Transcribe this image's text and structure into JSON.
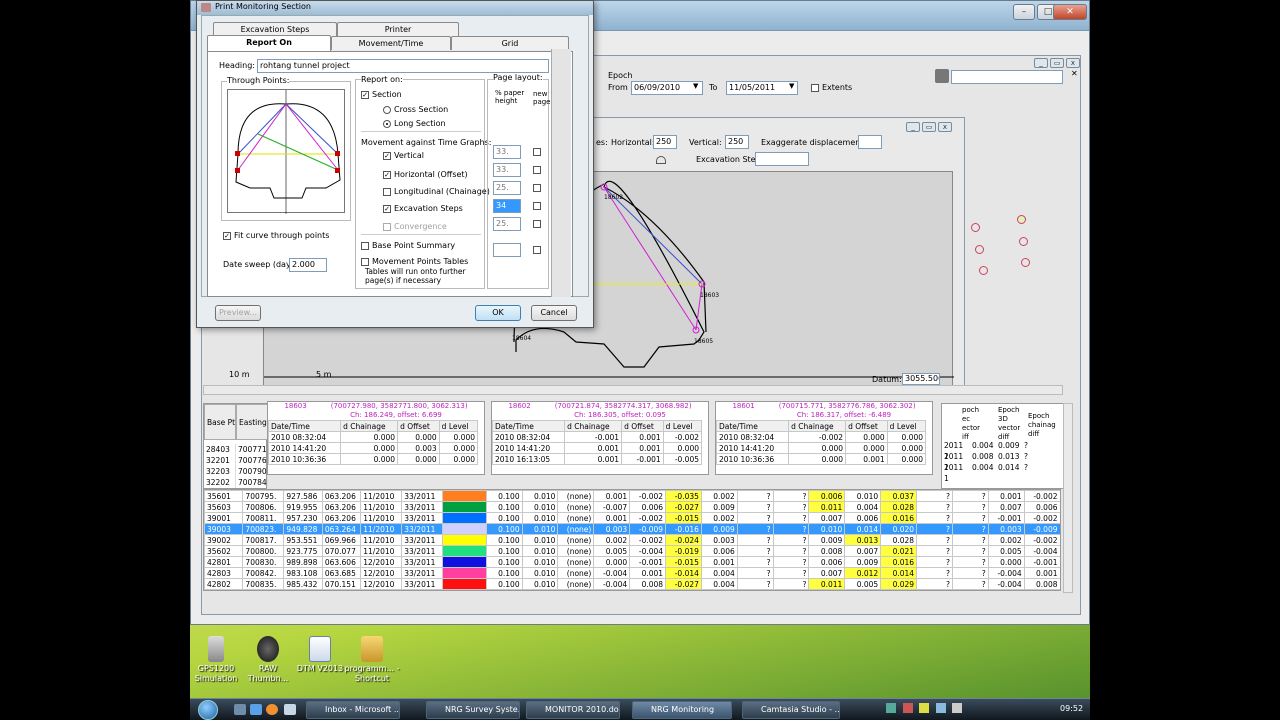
{
  "dialog": {
    "title": "Print Monitoring Section",
    "tabs_row1": [
      "Excavation Steps",
      "Printer"
    ],
    "tabs_row2": [
      "Report On",
      "Movement/Time",
      "Grid"
    ],
    "heading_label": "Heading:",
    "heading_value": "rohtang tunnel project",
    "through_points_label": "Through Points:",
    "fit_curve": "Fit curve through points",
    "date_sweep_label": "Date sweep (days):",
    "date_sweep_value": "2.000",
    "report_on_label": "Report on:",
    "section": "Section",
    "cross_section": "Cross Section",
    "long_section": "Long Section",
    "mat_label": "Movement against Time Graphs:",
    "vertical": "Vertical",
    "horizontal": "Horizontal (Offset)",
    "longitudinal": "Longitudinal (Chainage)",
    "excavation_steps": "Excavation Steps",
    "convergence": "Convergence",
    "base_point_summary": "Base Point Summary",
    "movement_points_tables": "Movement Points Tables",
    "tables_note": "Tables will run onto further page(s) if necessary",
    "page_layout_label": "Page layout:",
    "pct_paper": "% paper height",
    "new_page": "new page",
    "pct_values": [
      "33.",
      "33.",
      "25.",
      "34",
      "25.",
      ""
    ],
    "preview": "Preview...",
    "ok": "OK",
    "cancel": "Cancel"
  },
  "main": {
    "epoch_label": "Epoch",
    "from_label": "From",
    "from_value": "06/09/2010",
    "to_label": "To",
    "to_value": "11/05/2011",
    "extents": "Extents",
    "horizontal_label": "Horizontal: 1:",
    "horizontal_value": "250",
    "vertical_label": "Vertical: 1:",
    "vertical_value": "250",
    "exaggerate": "Exaggerate displacement by:",
    "excavation_step": "Excavation Step",
    "partial_label": "es:",
    "datum_label": "Datum:",
    "datum_value": "3055.500",
    "scale_10m": "10 m",
    "scale_5m": "5 m",
    "pt_18602": "18602",
    "pt_18603": "18603",
    "pt_18604": "18604",
    "pt_18605": "18605"
  },
  "pointpanels": [
    {
      "id": "18603",
      "coords": "(700727.980, 3582771.800, 3062.313)",
      "ch": "Ch: 186.249, offset: 6.699",
      "rows": [
        [
          "2010 08:32:04",
          "0.000",
          "0.000",
          "0.000"
        ],
        [
          "2010 14:41:20",
          "0.000",
          "0.003",
          "0.000"
        ],
        [
          "2010 10:36:36",
          "0.000",
          "0.000",
          "0.000"
        ]
      ]
    },
    {
      "id": "18602",
      "coords": "(700721.874, 3582774.317, 3068.982)",
      "ch": "Ch: 186.305, offset: 0.095",
      "rows": [
        [
          "2010 08:32:04",
          "-0.001",
          "0.001",
          "-0.002"
        ],
        [
          "2010 14:41:20",
          "0.001",
          "0.001",
          "0.000"
        ],
        [
          "2010 16:13:05",
          "0.001",
          "-0.001",
          "-0.005"
        ]
      ]
    },
    {
      "id": "18601",
      "coords": "(700715.771, 3582776.786, 3062.302)",
      "ch": "Ch: 186.317, offset: -6.489",
      "rows": [
        [
          "2010 08:32:04",
          "-0.002",
          "0.000",
          "0.000"
        ],
        [
          "2010 14:41:20",
          "0.000",
          "0.000",
          "0.000"
        ],
        [
          "2010 10:36:36",
          "0.000",
          "0.001",
          "0.000"
        ]
      ]
    }
  ],
  "panel_headers": [
    "Date/Time",
    "d Chainage",
    "d Offset",
    "d Level"
  ],
  "left_table": {
    "headers": [
      "Base Pt",
      "Easting"
    ],
    "rows": [
      [
        "28403",
        "700771"
      ],
      [
        "32201",
        "700776"
      ],
      [
        "32203",
        "700790"
      ],
      [
        "32202",
        "700784"
      ]
    ]
  },
  "epoch_headers": [
    "Date/Ti",
    "Epoch 3D vector diff",
    "Epoch chainag diff"
  ],
  "epoch_rows": [
    [
      "2011 1",
      "0.004",
      "0.009",
      "?"
    ],
    [
      "2011 1",
      "0.008",
      "0.013",
      "?"
    ],
    [
      "2011 1",
      "0.004",
      "0.014",
      "?"
    ]
  ],
  "partial_top": [
    "poch",
    "ec",
    "ector",
    "iff"
  ],
  "data_rows": [
    {
      "bp": "35601",
      "e": "700795.",
      "n": "927.586",
      "z": "063.206",
      "d1": "11/2010",
      "d2": "33/2011",
      "color": "#ff7f1e",
      "v": [
        "0.100",
        "0.010",
        "(none)",
        "0.001",
        "-0.002",
        "-0.035",
        "0.002",
        "?",
        "?",
        "0.006",
        "0.010",
        "0.037",
        "?",
        "?",
        "0.001",
        "-0.002",
        "-0.035",
        "0.002",
        "0.035",
        "?"
      ],
      "hl": [
        5,
        11,
        9
      ]
    },
    {
      "bp": "35603",
      "e": "700806.",
      "n": "919.955",
      "z": "063.206",
      "d1": "11/2010",
      "d2": "33/2011",
      "color": "#00a040",
      "v": [
        "0.100",
        "0.010",
        "(none)",
        "-0.007",
        "0.006",
        "-0.027",
        "0.009",
        "?",
        "?",
        "0.011",
        "0.004",
        "0.028",
        "?",
        "?",
        "0.007",
        "0.006",
        "-0.027",
        "0.009",
        "0.028",
        "?"
      ],
      "hl": [
        5,
        11,
        9
      ]
    },
    {
      "bp": "39001",
      "e": "700811.",
      "n": "957.230",
      "z": "063.206",
      "d1": "11/2010",
      "d2": "33/2011",
      "color": "#0070ff",
      "v": [
        "0.100",
        "0.010",
        "(none)",
        "0.001",
        "-0.002",
        "-0.015",
        "0.002",
        "?",
        "?",
        "0.007",
        "0.006",
        "0.016",
        "?",
        "?",
        "-0.001",
        "-0.002",
        "-0.015",
        "0.002",
        "0.015",
        "?"
      ],
      "hl": [
        5,
        11
      ]
    },
    {
      "bp": "39003",
      "e": "700823.",
      "n": "949.828",
      "z": "063.264",
      "d1": "11/2010",
      "d2": "33/2011",
      "color": "#d0d0ff",
      "v": [
        "0.100",
        "0.010",
        "(none)",
        "0.003",
        "-0.009",
        "-0.016",
        "0.009",
        "?",
        "?",
        "0.010",
        "0.014",
        "0.020",
        "?",
        "?",
        "0.003",
        "-0.009",
        "-0.016",
        "0.009",
        "0.019",
        "?"
      ],
      "hl": [],
      "sel": true
    },
    {
      "bp": "39002",
      "e": "700817.",
      "n": "953.551",
      "z": "069.966",
      "d1": "11/2010",
      "d2": "33/2011",
      "color": "#ffff00",
      "v": [
        "0.100",
        "0.010",
        "(none)",
        "0.002",
        "-0.002",
        "-0.024",
        "0.003",
        "?",
        "?",
        "0.009",
        "0.013",
        "0.028",
        "?",
        "?",
        "0.002",
        "-0.002",
        "-0.024",
        "0.003",
        "0.024",
        "?"
      ],
      "hl": [
        5,
        10
      ]
    },
    {
      "bp": "35602",
      "e": "700800.",
      "n": "923.775",
      "z": "070.077",
      "d1": "11/2010",
      "d2": "33/2011",
      "color": "#20e080",
      "v": [
        "0.100",
        "0.010",
        "(none)",
        "0.005",
        "-0.004",
        "-0.019",
        "0.006",
        "?",
        "?",
        "0.008",
        "0.007",
        "0.021",
        "?",
        "?",
        "0.005",
        "-0.004",
        "-0.019",
        "0.006",
        "0.020",
        "?"
      ],
      "hl": [
        5,
        11
      ]
    },
    {
      "bp": "42801",
      "e": "700830.",
      "n": "989.898",
      "z": "063.606",
      "d1": "12/2010",
      "d2": "33/2011",
      "color": "#1010e0",
      "v": [
        "0.100",
        "0.010",
        "(none)",
        "0.000",
        "-0.001",
        "-0.015",
        "0.001",
        "?",
        "?",
        "0.006",
        "0.009",
        "0.016",
        "?",
        "?",
        "0.000",
        "-0.001",
        "-0.015",
        "0.001",
        "0.015",
        "?"
      ],
      "hl": [
        5,
        11
      ]
    },
    {
      "bp": "42803",
      "e": "700842.",
      "n": "983.108",
      "z": "063.685",
      "d1": "12/2010",
      "d2": "33/2011",
      "color": "#ff40a0",
      "v": [
        "0.100",
        "0.010",
        "(none)",
        "-0.004",
        "0.001",
        "-0.014",
        "0.004",
        "?",
        "?",
        "0.007",
        "0.012",
        "0.014",
        "?",
        "?",
        "-0.004",
        "0.001",
        "-0.014",
        "0.004",
        "0.015",
        "?"
      ],
      "hl": [
        5,
        10,
        11
      ]
    },
    {
      "bp": "42802",
      "e": "700835.",
      "n": "985.432",
      "z": "070.151",
      "d1": "12/2010",
      "d2": "33/2011",
      "color": "#ff1010",
      "v": [
        "0.100",
        "0.010",
        "(none)",
        "-0.004",
        "0.008",
        "-0.027",
        "0.004",
        "?",
        "?",
        "0.011",
        "0.005",
        "0.029",
        "?",
        "?",
        "-0.004",
        "0.008",
        "-0.027",
        "0.004",
        "0.027",
        "?"
      ],
      "hl": [
        5,
        9,
        11
      ]
    }
  ],
  "desktop_icons": [
    {
      "label": "GPS1200 Simulation"
    },
    {
      "label": "RAW Thumbn..."
    },
    {
      "label": "DTM V2013"
    },
    {
      "label": "programm... - Shortcut"
    }
  ],
  "taskbar": {
    "items": [
      "Inbox - Microsoft ...",
      "NRG Survey Syste...",
      "MONITOR 2010.do...",
      "NRG Monitoring",
      "Camtasia Studio - ..."
    ],
    "clock": "09:52"
  }
}
